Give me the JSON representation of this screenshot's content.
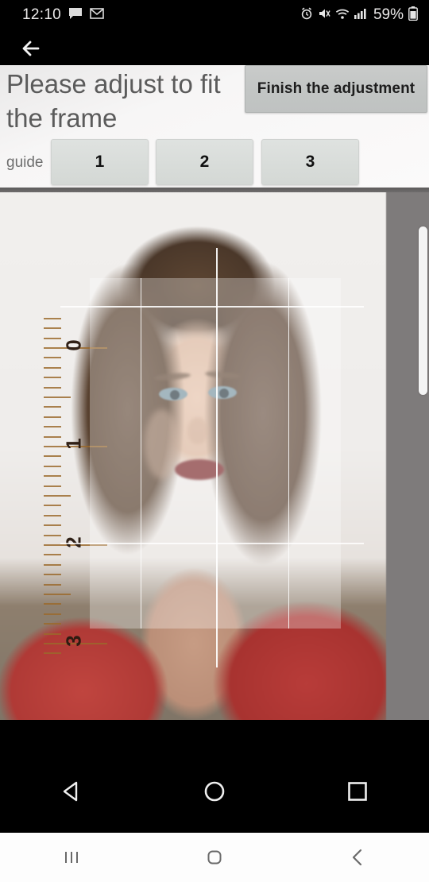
{
  "status_bar": {
    "time": "12:10",
    "battery_percent": "59%",
    "left_icons": [
      "message-icon",
      "gmail-icon"
    ],
    "right_icons": [
      "alarm-icon",
      "mute-icon",
      "wifi-icon",
      "signal-icon",
      "battery-icon"
    ]
  },
  "app_bar": {
    "back_icon": "back-arrow-icon"
  },
  "header": {
    "title": "Please adjust to fit the frame",
    "finish_button": "Finish the adjustment",
    "guide_label": "guide",
    "guide_buttons": [
      {
        "label": "1"
      },
      {
        "label": "2"
      },
      {
        "label": "3"
      }
    ]
  },
  "canvas": {
    "description": "passport photo adjustment preview",
    "ruler_numbers": [
      "0",
      "1",
      "2",
      "3"
    ],
    "background_color": "#7e7b7b",
    "frame_overlay_color": "#ffffff"
  },
  "app_nav": {
    "items": [
      {
        "icon": "back-triangle-icon"
      },
      {
        "icon": "home-circle-icon"
      },
      {
        "icon": "recents-square-icon"
      }
    ]
  },
  "system_nav": {
    "items": [
      {
        "icon": "recents-bars-icon"
      },
      {
        "icon": "home-square-icon"
      },
      {
        "icon": "back-chevron-icon"
      }
    ]
  }
}
